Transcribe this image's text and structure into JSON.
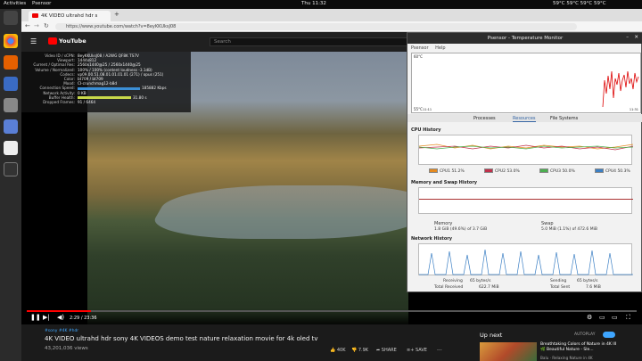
{
  "topbar": {
    "activities": "Activities",
    "app": "Psensor",
    "clock": "Thu 11:32",
    "temps": "59°C 59°C 59°C 59°C"
  },
  "browser": {
    "tab_title": "4K VIDEO ultrahd hdr s",
    "url": "https://www.youtube.com/watch?v=8eyKKUksJ08"
  },
  "youtube": {
    "search_placeholder": "Search",
    "logo": "YouTube",
    "stats": [
      {
        "k": "Video ID / sCPN",
        "v": "8eyKKUksJ08 / A2WG QF8K TS7V"
      },
      {
        "k": "Viewport",
        "v": "1444x812"
      },
      {
        "k": "Current / Optimal Res",
        "v": "2560x1440@25 / 2560x1440@25"
      },
      {
        "k": "Volume / Normalized",
        "v": "100% / 100% (content loudness -3.1dB)"
      },
      {
        "k": "Codecs",
        "v": "vp09.00.51.08.01.01.01.01 (271) / opus (251)"
      },
      {
        "k": "Color",
        "v": "bt709 / bt709"
      },
      {
        "k": "Mood",
        "v": "CI-crunchmag12-b8d"
      },
      {
        "k": "Connection Speed",
        "v": "185882 Kbps"
      },
      {
        "k": "Network Activity",
        "v": "0 KB"
      },
      {
        "k": "Buffer Health",
        "v": "31.80 s"
      },
      {
        "k": "Dropped Frames",
        "v": "91 / 6464"
      }
    ],
    "time": "2:29 / 23:36",
    "channel": "#sony #4K #hdr",
    "title": "4K VIDEO ultrahd hdr sony 4K VIDEOS demo test nature relaxation movie for 4k oled tv",
    "views": "43,201,036 views",
    "likes": "40K",
    "dislikes": "7.9K",
    "share": "SHARE",
    "save": "SAVE",
    "up_next": "Up next",
    "autoplay": "AUTOPLAY",
    "next_title": "Breathtaking Colors of Nature in 4K III 🌿 Beautiful Nature - Sle...",
    "next_channel": "Balu · Relaxing Nature in 4K"
  },
  "psensor": {
    "title": "Psensor - Temperature Monitor",
    "menu": [
      "Psensor",
      "Help"
    ],
    "yhi": "60°C",
    "ylo": "55°C",
    "t1": "11:11",
    "t2": "11:31",
    "tabs": [
      "Processes",
      "Resources",
      "File Systems"
    ],
    "cpu_title": "CPU History",
    "cpu": [
      {
        "name": "CPU1",
        "val": "51.2%",
        "color": "#e58a1f"
      },
      {
        "name": "CPU2",
        "val": "53.0%",
        "color": "#c0304a"
      },
      {
        "name": "CPU3",
        "val": "50.0%",
        "color": "#4caf50"
      },
      {
        "name": "CPU4",
        "val": "50.3%",
        "color": "#3b7fc4"
      }
    ],
    "mem_title": "Memory and Swap History",
    "mem_label": "Memory",
    "mem_val": "1.8 GiB (49.6%) of 3.7 GiB",
    "swap_label": "Swap",
    "swap_val": "5.0 MiB (1.1%) of 472.6 MiB",
    "net_title": "Network History",
    "recv_label": "Receiving",
    "recv_val": "65 bytes/s",
    "recv_total": "Total Received",
    "recv_total_val": "622.7 MiB",
    "send_label": "Sending",
    "send_val": "65 bytes/s",
    "send_total": "Total Sent",
    "send_total_val": "7.6 MiB"
  }
}
